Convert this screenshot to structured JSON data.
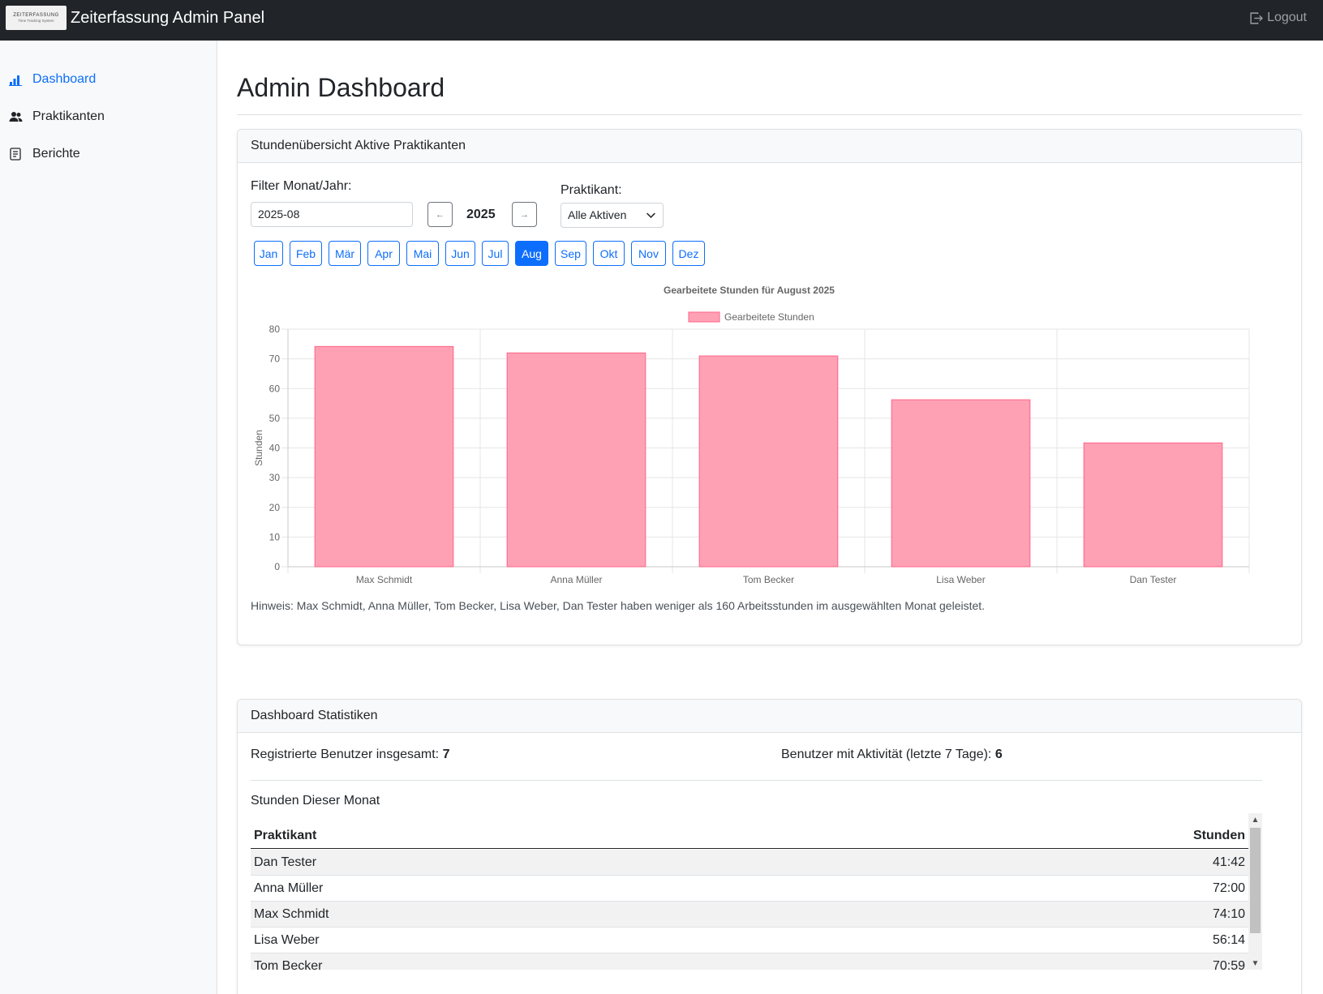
{
  "app": {
    "logo_line1": "ZEITERFASSUNG",
    "logo_line2": "Time Tracking System",
    "title": "Zeiterfassung Admin Panel",
    "logout_label": "Logout"
  },
  "sidebar": {
    "items": [
      {
        "label": "Dashboard",
        "icon": "bar-chart-icon",
        "active": true
      },
      {
        "label": "Praktikanten",
        "icon": "people-icon",
        "active": false
      },
      {
        "label": "Berichte",
        "icon": "document-icon",
        "active": false
      }
    ]
  },
  "page": {
    "title": "Admin Dashboard"
  },
  "hours_card": {
    "header": "Stundenübersicht Aktive Praktikanten",
    "filter_label": "Filter Monat/Jahr:",
    "month_value": "2025-08",
    "prev_label": "←",
    "next_label": "→",
    "year": "2025",
    "intern_label": "Praktikant:",
    "intern_selected": "Alle Aktiven",
    "months": [
      "Jan",
      "Feb",
      "Mär",
      "Apr",
      "Mai",
      "Jun",
      "Jul",
      "Aug",
      "Sep",
      "Okt",
      "Nov",
      "Dez"
    ],
    "active_month": "Aug",
    "hint": "Hinweis: Max Schmidt, Anna Müller, Tom Becker, Lisa Weber, Dan Tester haben weniger als 160 Arbeitsstunden im ausgewählten Monat geleistet."
  },
  "chart_data": {
    "type": "bar",
    "title": "Gearbeitete Stunden für August 2025",
    "xlabel": "",
    "ylabel": "Stunden",
    "categories": [
      "Max Schmidt",
      "Anna Müller",
      "Tom Becker",
      "Lisa Weber",
      "Dan Tester"
    ],
    "series": [
      {
        "name": "Gearbeitete Stunden",
        "values": [
          74.17,
          72.0,
          70.98,
          56.23,
          41.7
        ],
        "color": "#ffa1b5",
        "border": "#ff6384"
      }
    ],
    "ylim": [
      0,
      80
    ],
    "yticks": [
      0,
      10,
      20,
      30,
      40,
      50,
      60,
      70,
      80
    ],
    "grid": true,
    "legend": "top-center"
  },
  "stats_card": {
    "header": "Dashboard Statistiken",
    "registered_label": "Registrierte Benutzer insgesamt:",
    "registered_value": "7",
    "active_label": "Benutzer mit Aktivität (letzte 7 Tage):",
    "active_value": "6",
    "subheading": "Stunden Dieser Monat",
    "columns": [
      "Praktikant",
      "Stunden"
    ],
    "rows": [
      {
        "name": "Dan Tester",
        "hours": "41:42"
      },
      {
        "name": "Anna Müller",
        "hours": "72:00"
      },
      {
        "name": "Max Schmidt",
        "hours": "74:10"
      },
      {
        "name": "Lisa Weber",
        "hours": "56:14"
      },
      {
        "name": "Tom Becker",
        "hours": "70:59"
      }
    ]
  }
}
